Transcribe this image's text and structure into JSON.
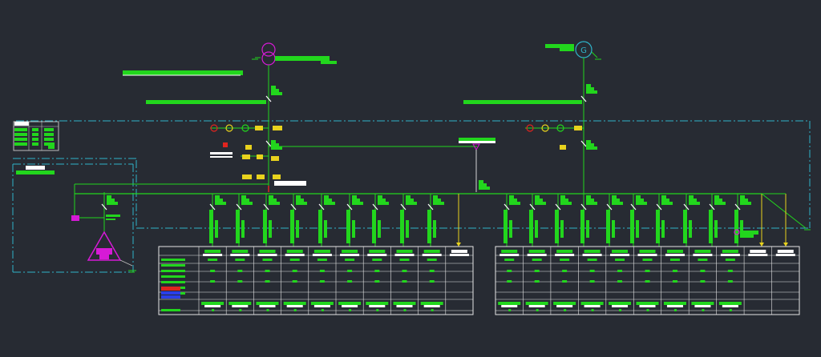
{
  "drawing": {
    "background": "#272b33",
    "colors": {
      "green": "#22d61d",
      "bright_green": "#39ff14",
      "white": "#ffffff",
      "cyan_dash": "#2fb3c9",
      "yellow": "#e8d21d",
      "magenta": "#d61ad6",
      "red": "#e0241f",
      "blue": "#2a3fe8",
      "table_line": "#e6e6e6",
      "gray_line": "#bdbdbd"
    },
    "left_bus": {
      "source_symbol": "transformer-circle-icon",
      "feeder_count": 9
    },
    "right_bus": {
      "source_symbol": "generator-icon",
      "generator_letter": "G",
      "feeder_count": 10
    },
    "left_table": {
      "columns": 10,
      "rows": 7
    },
    "right_table": {
      "columns": 11,
      "rows": 7
    },
    "labels_legible": false
  }
}
